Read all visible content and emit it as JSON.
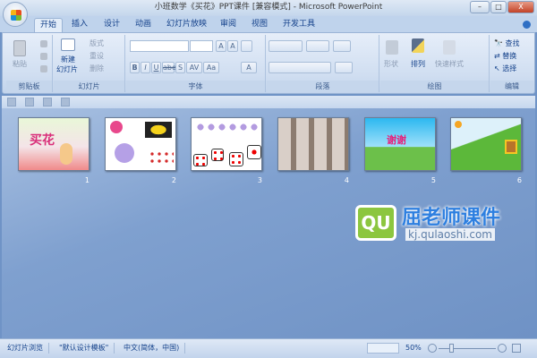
{
  "window": {
    "title": "小班数学《买花》PPT课件 [兼容模式] - Microsoft PowerPoint",
    "min": "–",
    "max": "□",
    "close": "X"
  },
  "tabs": [
    "开始",
    "插入",
    "设计",
    "动画",
    "幻灯片放映",
    "审阅",
    "视图",
    "开发工具"
  ],
  "ribbon": {
    "clipboard": {
      "paste": "粘贴",
      "label": "剪贴板"
    },
    "slides": {
      "new_slide_1": "新建",
      "new_slide_2": "幻灯片",
      "layout": "版式",
      "reset": "重设",
      "delete": "删除",
      "label": "幻灯片"
    },
    "font": {
      "grow": "A",
      "shrink": "A",
      "bold": "B",
      "italic": "I",
      "underline": "U",
      "strike": "abe",
      "shadow": "S",
      "spacing": "AV",
      "case": "Aa",
      "color": "A",
      "label": "字体"
    },
    "paragraph": {
      "label": "段落"
    },
    "drawing": {
      "shapes": "形状",
      "arrange": "排列",
      "quick_styles": "快速样式",
      "label": "绘图"
    },
    "editing": {
      "find": "查找",
      "replace": "替换",
      "select": "选择",
      "label": "编辑"
    }
  },
  "slides": [
    {
      "number": "1",
      "title": "买花"
    },
    {
      "number": "2"
    },
    {
      "number": "3"
    },
    {
      "number": "4"
    },
    {
      "number": "5",
      "title": "谢谢"
    },
    {
      "number": "6"
    }
  ],
  "watermark": {
    "logo": "QU",
    "name": "屈老师课件",
    "url": "kj.qulaoshi.com"
  },
  "status": {
    "view": "幻灯片浏览",
    "theme": "\"默认设计模板\"",
    "language": "中文(简体，中国)",
    "zoom": "50%",
    "zoom_percent": 50
  }
}
